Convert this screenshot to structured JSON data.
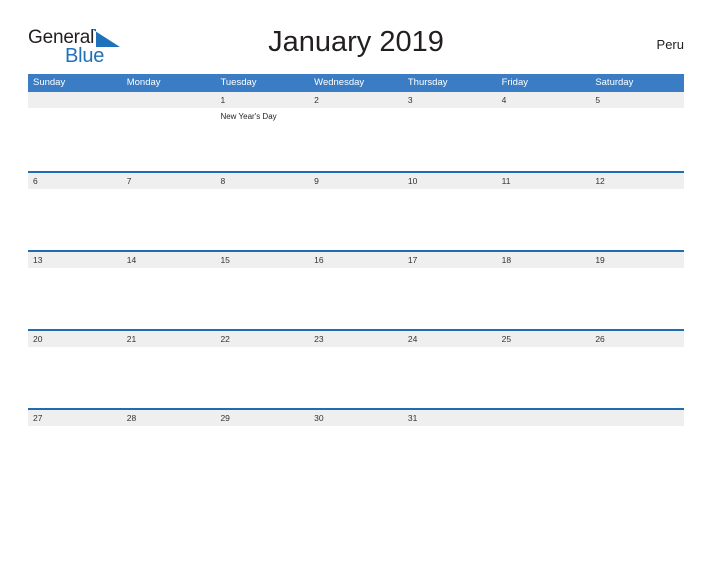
{
  "logo": {
    "word_one": "General",
    "word_two": "Blue",
    "icon": "blue-triangle-icon",
    "brand_blue": "#1e72bb",
    "brand_dark": "#231f20"
  },
  "header": {
    "title": "January 2019",
    "country": "Peru"
  },
  "calendar": {
    "header_bg": "#3b7dc4",
    "row_line_color": "#1f6cb0",
    "number_band_bg": "#efefef",
    "weekdays": [
      "Sunday",
      "Monday",
      "Tuesday",
      "Wednesday",
      "Thursday",
      "Friday",
      "Saturday"
    ],
    "weeks": [
      {
        "days": [
          {
            "num": "",
            "event": ""
          },
          {
            "num": "",
            "event": ""
          },
          {
            "num": "1",
            "event": "New Year's Day"
          },
          {
            "num": "2",
            "event": ""
          },
          {
            "num": "3",
            "event": ""
          },
          {
            "num": "4",
            "event": ""
          },
          {
            "num": "5",
            "event": ""
          }
        ]
      },
      {
        "days": [
          {
            "num": "6",
            "event": ""
          },
          {
            "num": "7",
            "event": ""
          },
          {
            "num": "8",
            "event": ""
          },
          {
            "num": "9",
            "event": ""
          },
          {
            "num": "10",
            "event": ""
          },
          {
            "num": "11",
            "event": ""
          },
          {
            "num": "12",
            "event": ""
          }
        ]
      },
      {
        "days": [
          {
            "num": "13",
            "event": ""
          },
          {
            "num": "14",
            "event": ""
          },
          {
            "num": "15",
            "event": ""
          },
          {
            "num": "16",
            "event": ""
          },
          {
            "num": "17",
            "event": ""
          },
          {
            "num": "18",
            "event": ""
          },
          {
            "num": "19",
            "event": ""
          }
        ]
      },
      {
        "days": [
          {
            "num": "20",
            "event": ""
          },
          {
            "num": "21",
            "event": ""
          },
          {
            "num": "22",
            "event": ""
          },
          {
            "num": "23",
            "event": ""
          },
          {
            "num": "24",
            "event": ""
          },
          {
            "num": "25",
            "event": ""
          },
          {
            "num": "26",
            "event": ""
          }
        ]
      },
      {
        "days": [
          {
            "num": "27",
            "event": ""
          },
          {
            "num": "28",
            "event": ""
          },
          {
            "num": "29",
            "event": ""
          },
          {
            "num": "30",
            "event": ""
          },
          {
            "num": "31",
            "event": ""
          },
          {
            "num": "",
            "event": ""
          },
          {
            "num": "",
            "event": ""
          }
        ]
      }
    ]
  }
}
